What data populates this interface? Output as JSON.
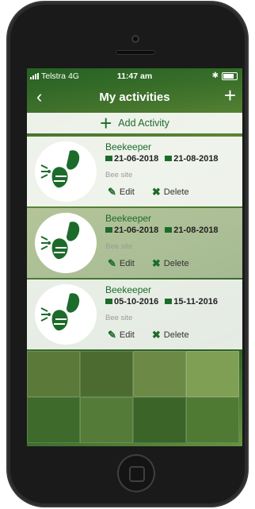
{
  "status": {
    "carrier": "Telstra",
    "network": "4G",
    "time": "11:47 am"
  },
  "navbar": {
    "title": "My activities",
    "back_icon": "chevron-left-icon",
    "add_icon": "plus-icon"
  },
  "add_activity": {
    "label": "Add Activity"
  },
  "activities": [
    {
      "title": "Beekeeper",
      "start": "21-06-2018",
      "end": "21-08-2018",
      "site": "Bee site",
      "edit": "Edit",
      "delete": "Delete"
    },
    {
      "title": "Beekeeper",
      "start": "21-06-2018",
      "end": "21-08-2018",
      "site": "Bee site",
      "edit": "Edit",
      "delete": "Delete"
    },
    {
      "title": "Beekeeper",
      "start": "05-10-2016",
      "end": "15-11-2016",
      "site": "Bee site",
      "edit": "Edit",
      "delete": "Delete"
    }
  ],
  "colors": {
    "brand_green": "#1d6b2b"
  }
}
